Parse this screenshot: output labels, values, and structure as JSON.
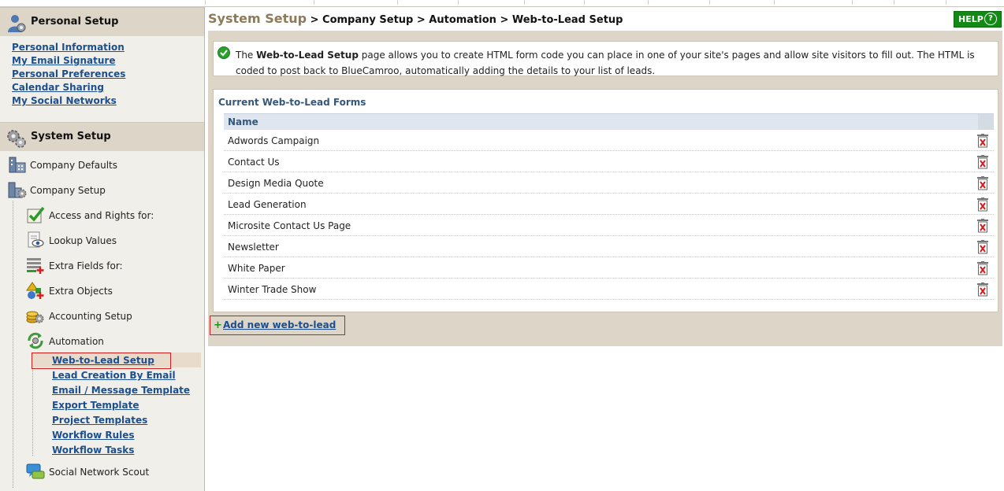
{
  "sidebar": {
    "personal_title": "Personal Setup",
    "personal_links": [
      "Personal Information",
      "My Email Signature",
      "Personal Preferences",
      "Calendar Sharing",
      "My Social Networks"
    ],
    "system_title": "System Setup",
    "items": [
      "Company Defaults",
      "Company Setup",
      "Access and Rights for:",
      "Lookup Values",
      "Extra Fields for:",
      "Extra Objects",
      "Accounting Setup",
      "Automation"
    ],
    "automation_links": [
      "Web-to-Lead Setup",
      "Lead Creation By Email",
      "Email / Message Template",
      "Export Template",
      "Project Templates",
      "Workflow Rules",
      "Workflow Tasks"
    ],
    "scout": "Social Network Scout"
  },
  "breadcrumb": {
    "root": "System Setup",
    "rest": " > Company Setup > Automation > Web-to-Lead Setup"
  },
  "help_label": "HELP",
  "help_icon": "?",
  "info": {
    "pre": "The ",
    "bold": "Web-to-Lead Setup",
    "post": " page allows you to create HTML form code you can place in one of your site's pages and allow site visitors to fill out. The HTML is coded to post back to BlueCamroo, automatically adding the details to your list of leads."
  },
  "forms": {
    "title": "Current Web-to-Lead Forms",
    "column": "Name",
    "rows": [
      "Adwords Campaign",
      "Contact Us",
      "Design Media Quote",
      "Lead Generation",
      "Microsite Contact Us Page",
      "Newsletter",
      "White Paper",
      "Winter Trade Show"
    ]
  },
  "add_plus": "+",
  "add_label": "Add new web-to-lead",
  "colors": {
    "link": "#1d4f8f",
    "header_bg": "#ddd5c8",
    "help_bg": "#128a14",
    "highlight": "#d21d1d"
  }
}
